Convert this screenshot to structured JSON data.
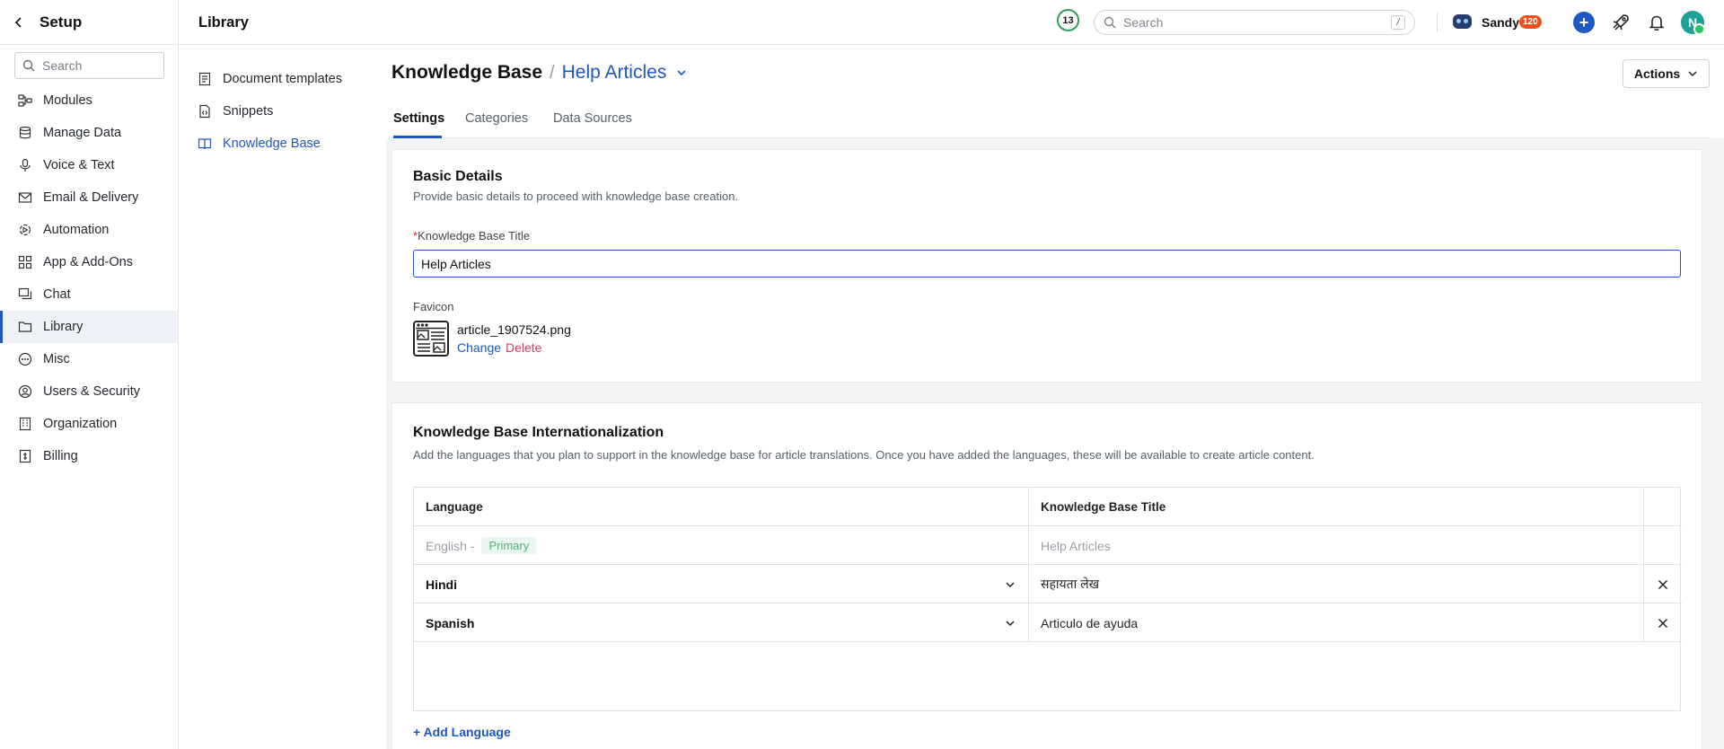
{
  "setup": {
    "title": "Setup",
    "search_placeholder": "Search",
    "items": [
      {
        "label": "Modules",
        "icon": "modules-icon"
      },
      {
        "label": "Manage Data",
        "icon": "database-icon"
      },
      {
        "label": "Voice & Text",
        "icon": "microphone-icon"
      },
      {
        "label": "Email & Delivery",
        "icon": "mail-icon"
      },
      {
        "label": "Automation",
        "icon": "automation-icon"
      },
      {
        "label": "App & Add-Ons",
        "icon": "apps-grid-icon"
      },
      {
        "label": "Chat",
        "icon": "chat-icon"
      },
      {
        "label": "Library",
        "icon": "folder-icon",
        "active": true
      },
      {
        "label": "Misc",
        "icon": "more-circle-icon"
      },
      {
        "label": "Users & Security",
        "icon": "user-circle-icon"
      },
      {
        "label": "Organization",
        "icon": "building-icon"
      },
      {
        "label": "Billing",
        "icon": "billing-icon"
      }
    ]
  },
  "topbar": {
    "section_title": "Library",
    "notification_count": "13",
    "search_placeholder": "Search",
    "search_shortcut": "/",
    "user_name": "Sandy",
    "user_badge": "120",
    "avatar_initial": "N"
  },
  "library_nav": {
    "items": [
      {
        "label": "Document templates",
        "icon": "document-template-icon"
      },
      {
        "label": "Snippets",
        "icon": "snippet-icon"
      },
      {
        "label": "Knowledge Base",
        "icon": "book-icon",
        "active": true
      }
    ]
  },
  "page": {
    "root_title": "Knowledge Base",
    "separator": "/",
    "current": "Help Articles",
    "actions_label": "Actions",
    "tabs": [
      {
        "label": "Settings",
        "active": true
      },
      {
        "label": "Categories"
      },
      {
        "label": "Data Sources"
      }
    ]
  },
  "basic_details": {
    "title": "Basic Details",
    "description": "Provide basic details to proceed with knowledge base creation.",
    "required_mark": "*",
    "kb_title_label": "Knowledge Base Title",
    "kb_title_value": "Help Articles",
    "favicon_label": "Favicon",
    "favicon_file": "article_1907524.png",
    "change_label": "Change",
    "delete_label": "Delete"
  },
  "intl": {
    "title": "Knowledge Base Internationalization",
    "description": "Add the languages that you plan to support in the knowledge base for article translations. Once you have added the languages, these will be available to create article content.",
    "columns": [
      "Language",
      "Knowledge Base Title"
    ],
    "primary": {
      "language": "English -",
      "badge": "Primary",
      "title": "Help Articles"
    },
    "rows": [
      {
        "language": "Hindi",
        "title": "सहायता लेख"
      },
      {
        "language": "Spanish",
        "title": "Articulo de ayuda"
      }
    ],
    "add_label": "+ Add Language"
  },
  "colors": {
    "accent": "#1f57c3",
    "delete": "#d63a63",
    "badge": "#e8501f",
    "primary_badge_bg": "#e9f7ee"
  }
}
